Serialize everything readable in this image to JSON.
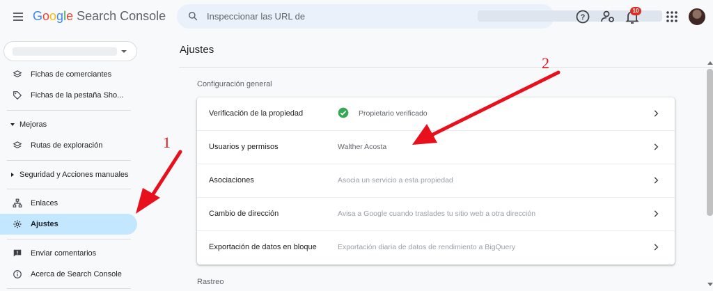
{
  "header": {
    "logo_google": [
      "G",
      "o",
      "o",
      "g",
      "l",
      "e"
    ],
    "logo_product": "Search Console",
    "search_placeholder": "Inspeccionar las URL de",
    "notification_count": "10"
  },
  "sidebar": {
    "items": [
      {
        "label": "Fichas de comerciantes",
        "icon": "layers-icon"
      },
      {
        "label": "Fichas de la pestaña Sho...",
        "icon": "tag-icon"
      },
      {
        "section": "Mejoras"
      },
      {
        "label": "Rutas de exploración",
        "icon": "layers-icon"
      },
      {
        "section": "Seguridad y Acciones manuales"
      },
      {
        "label": "Enlaces",
        "icon": "sitemap-icon"
      },
      {
        "label": "Ajustes",
        "icon": "gear-icon",
        "active": true
      },
      {
        "label": "Enviar comentarios",
        "icon": "feedback-icon"
      },
      {
        "label": "Acerca de Search Console",
        "icon": "info-icon"
      }
    ]
  },
  "main": {
    "page_title": "Ajustes",
    "general_title": "Configuración general",
    "rows": [
      {
        "name": "Verificación de la propiedad",
        "value": "Propietario verificado",
        "status": "verified"
      },
      {
        "name": "Usuarios y permisos",
        "value": "Walther Acosta"
      },
      {
        "name": "Asociaciones",
        "value": "Asocia un servicio a esta propiedad"
      },
      {
        "name": "Cambio de dirección",
        "value": "Avisa a Google cuando traslades tu sitio web a otra dirección"
      },
      {
        "name": "Exportación de datos en bloque",
        "value": "Exportación diaria de datos de rendimiento a BigQuery"
      }
    ],
    "crawl_title": "Rastreo"
  },
  "annotations": {
    "one": "1",
    "two": "2"
  },
  "colors": {
    "accent_active": "#c2e7ff",
    "verified": "#34a853",
    "annotation": "#e8101c",
    "badge": "#d93025"
  }
}
